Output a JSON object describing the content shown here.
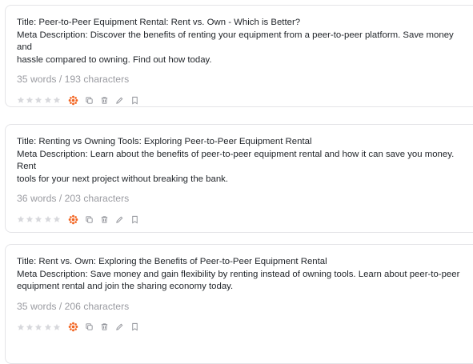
{
  "cards": [
    {
      "title": "Title: Peer-to-Peer Equipment Rental: Rent vs. Own - Which is Better?",
      "meta_lines": [
        "Meta Description: Discover the benefits of renting your equipment from a peer-to-peer platform. Save money and",
        "hassle compared to owning. Find out how today."
      ],
      "count": "35 words / 193 characters",
      "rating": 0
    },
    {
      "title": "Title: Renting vs Owning Tools: Exploring Peer-to-Peer Equipment Rental",
      "meta_lines": [
        "Meta Description: Learn about the benefits of peer-to-peer equipment rental and how it can save you money. Rent",
        "tools for your next project without breaking the bank."
      ],
      "count": "36 words / 203 characters",
      "rating": 0
    },
    {
      "title": "Title: Rent vs. Own: Exploring the Benefits of Peer-to-Peer Equipment Rental",
      "meta_lines": [
        "Meta Description: Save money and gain flexibility by renting instead of owning tools. Learn about peer-to-peer",
        "equipment rental and join the sharing economy today."
      ],
      "count": "35 words / 206 characters",
      "rating": 0
    }
  ],
  "icons": {
    "star": "star-icon",
    "ai": "orange-sparkle-icon",
    "copy": "copy-icon",
    "delete": "trash-icon",
    "edit": "pencil-icon",
    "bookmark": "bookmark-icon"
  },
  "colors": {
    "accent": "#f26522",
    "star": "#d7d8dc",
    "icon": "#8d8f96",
    "text": "#1f2328",
    "muted": "#9a9ba1",
    "border": "#e4e4e7"
  }
}
